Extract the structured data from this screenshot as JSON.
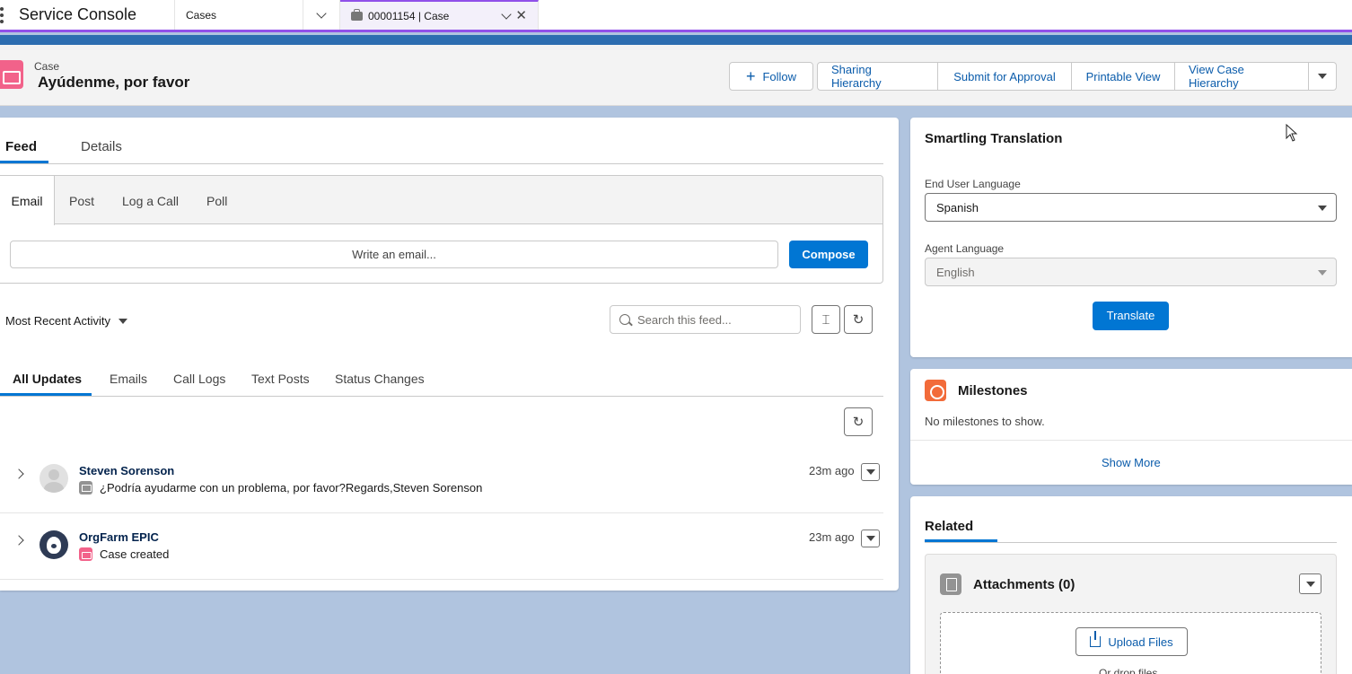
{
  "topnav": {
    "app_name": "Service Console",
    "object_tab": "Cases",
    "record_tab": "00001154 | Case"
  },
  "header": {
    "record_type": "Case",
    "record_title": "Ayúdenme, por favor",
    "buttons": {
      "follow": "Follow",
      "sharing_hierarchy": "Sharing Hierarchy",
      "submit_for_approval": "Submit for Approval",
      "printable_view": "Printable View",
      "view_case_hierarchy": "View Case Hierarchy"
    }
  },
  "main": {
    "tabs": [
      "Feed",
      "Details"
    ],
    "publisher": {
      "tabs": [
        "Email",
        "Post",
        "Log a Call",
        "Poll"
      ],
      "email_placeholder": "Write an email...",
      "compose_label": "Compose"
    },
    "sort_label": "Most Recent Activity",
    "search_placeholder": "Search this feed...",
    "filter_tabs": [
      "All Updates",
      "Emails",
      "Call Logs",
      "Text Posts",
      "Status Changes"
    ],
    "feed": [
      {
        "author": "Steven Sorenson",
        "body": "¿Podría ayudarme con un problema, por favor?Regards,Steven Sorenson",
        "time": "23m ago"
      },
      {
        "author": "OrgFarm EPIC",
        "body": "Case created",
        "time": "23m ago"
      }
    ]
  },
  "translation": {
    "title": "Smartling Translation",
    "end_user_label": "End User Language",
    "end_user_value": "Spanish",
    "agent_label": "Agent Language",
    "agent_value": "English",
    "translate_label": "Translate"
  },
  "milestones": {
    "title": "Milestones",
    "empty_text": "No milestones to show.",
    "show_more": "Show More"
  },
  "related": {
    "tab": "Related",
    "attachments_title": "Attachments (0)",
    "upload_label": "Upload Files",
    "drop_hint": "Or drop files"
  },
  "colors": {
    "brand_blue": "#0176d3",
    "link_blue": "#0b5cab",
    "case_pink": "#f2628a",
    "milestone_orange": "#f26b3a",
    "nav_accent": "#9050e9"
  }
}
